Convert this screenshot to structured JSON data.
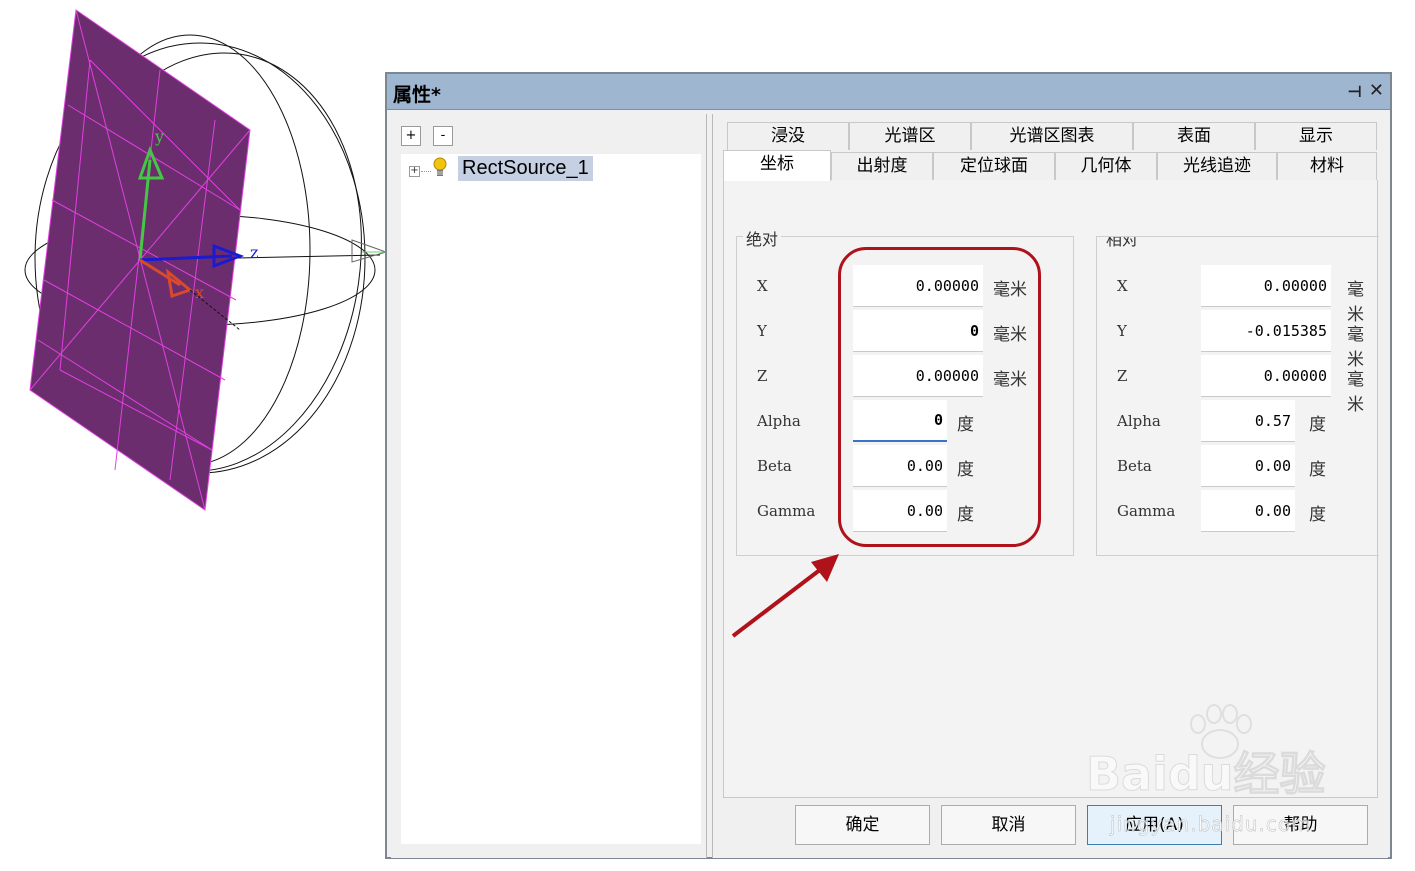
{
  "dialog": {
    "title": "属性*",
    "pin_glyph": "⊣",
    "close_glyph": "✕"
  },
  "tree": {
    "expand_all": "+",
    "collapse_all": "-",
    "expander": "+",
    "items": [
      {
        "label": "RectSource_1",
        "icon": "lightbulb-icon",
        "selected": true
      }
    ]
  },
  "tabs": {
    "row1": [
      "浸没",
      "光谱区",
      "光谱区图表",
      "表面",
      "显示"
    ],
    "row2": [
      "坐标",
      "出射度",
      "定位球面",
      "几何体",
      "光线追迹",
      "材料"
    ],
    "active": "坐标"
  },
  "absolute": {
    "title": "绝对",
    "rows": [
      {
        "label": "X",
        "value": "0.00000",
        "unit": "毫米"
      },
      {
        "label": "Y",
        "value": "0",
        "unit": "毫米"
      },
      {
        "label": "Z",
        "value": "0.00000",
        "unit": "毫米"
      },
      {
        "label": "Alpha",
        "value": "0",
        "unit": "度"
      },
      {
        "label": "Beta",
        "value": "0.00",
        "unit": "度"
      },
      {
        "label": "Gamma",
        "value": "0.00",
        "unit": "度"
      }
    ]
  },
  "relative": {
    "title": "相对",
    "rows": [
      {
        "label": "X",
        "value": "0.00000",
        "unit": "毫米"
      },
      {
        "label": "Y",
        "value": "-0.015385",
        "unit": "毫米"
      },
      {
        "label": "Z",
        "value": "0.00000",
        "unit": "毫米"
      },
      {
        "label": "Alpha",
        "value": "0.57",
        "unit": "度"
      },
      {
        "label": "Beta",
        "value": "0.00",
        "unit": "度"
      },
      {
        "label": "Gamma",
        "value": "0.00",
        "unit": "度"
      }
    ]
  },
  "buttons": {
    "ok": "确定",
    "cancel": "取消",
    "apply": "应用(A)",
    "help": "帮助"
  },
  "viewport": {
    "axis_y": "y",
    "axis_z": "z",
    "axis_x": "x"
  },
  "watermark": {
    "text": "Baidu经验",
    "url": "jingyan.baidu.com"
  },
  "colors": {
    "titlebar": "#9fb6d1",
    "plane": "#6b2d6e",
    "highlight": "#b0121b",
    "axis_x": "#d94a2a",
    "axis_y": "#44c844",
    "axis_z": "#1a1ad0"
  }
}
